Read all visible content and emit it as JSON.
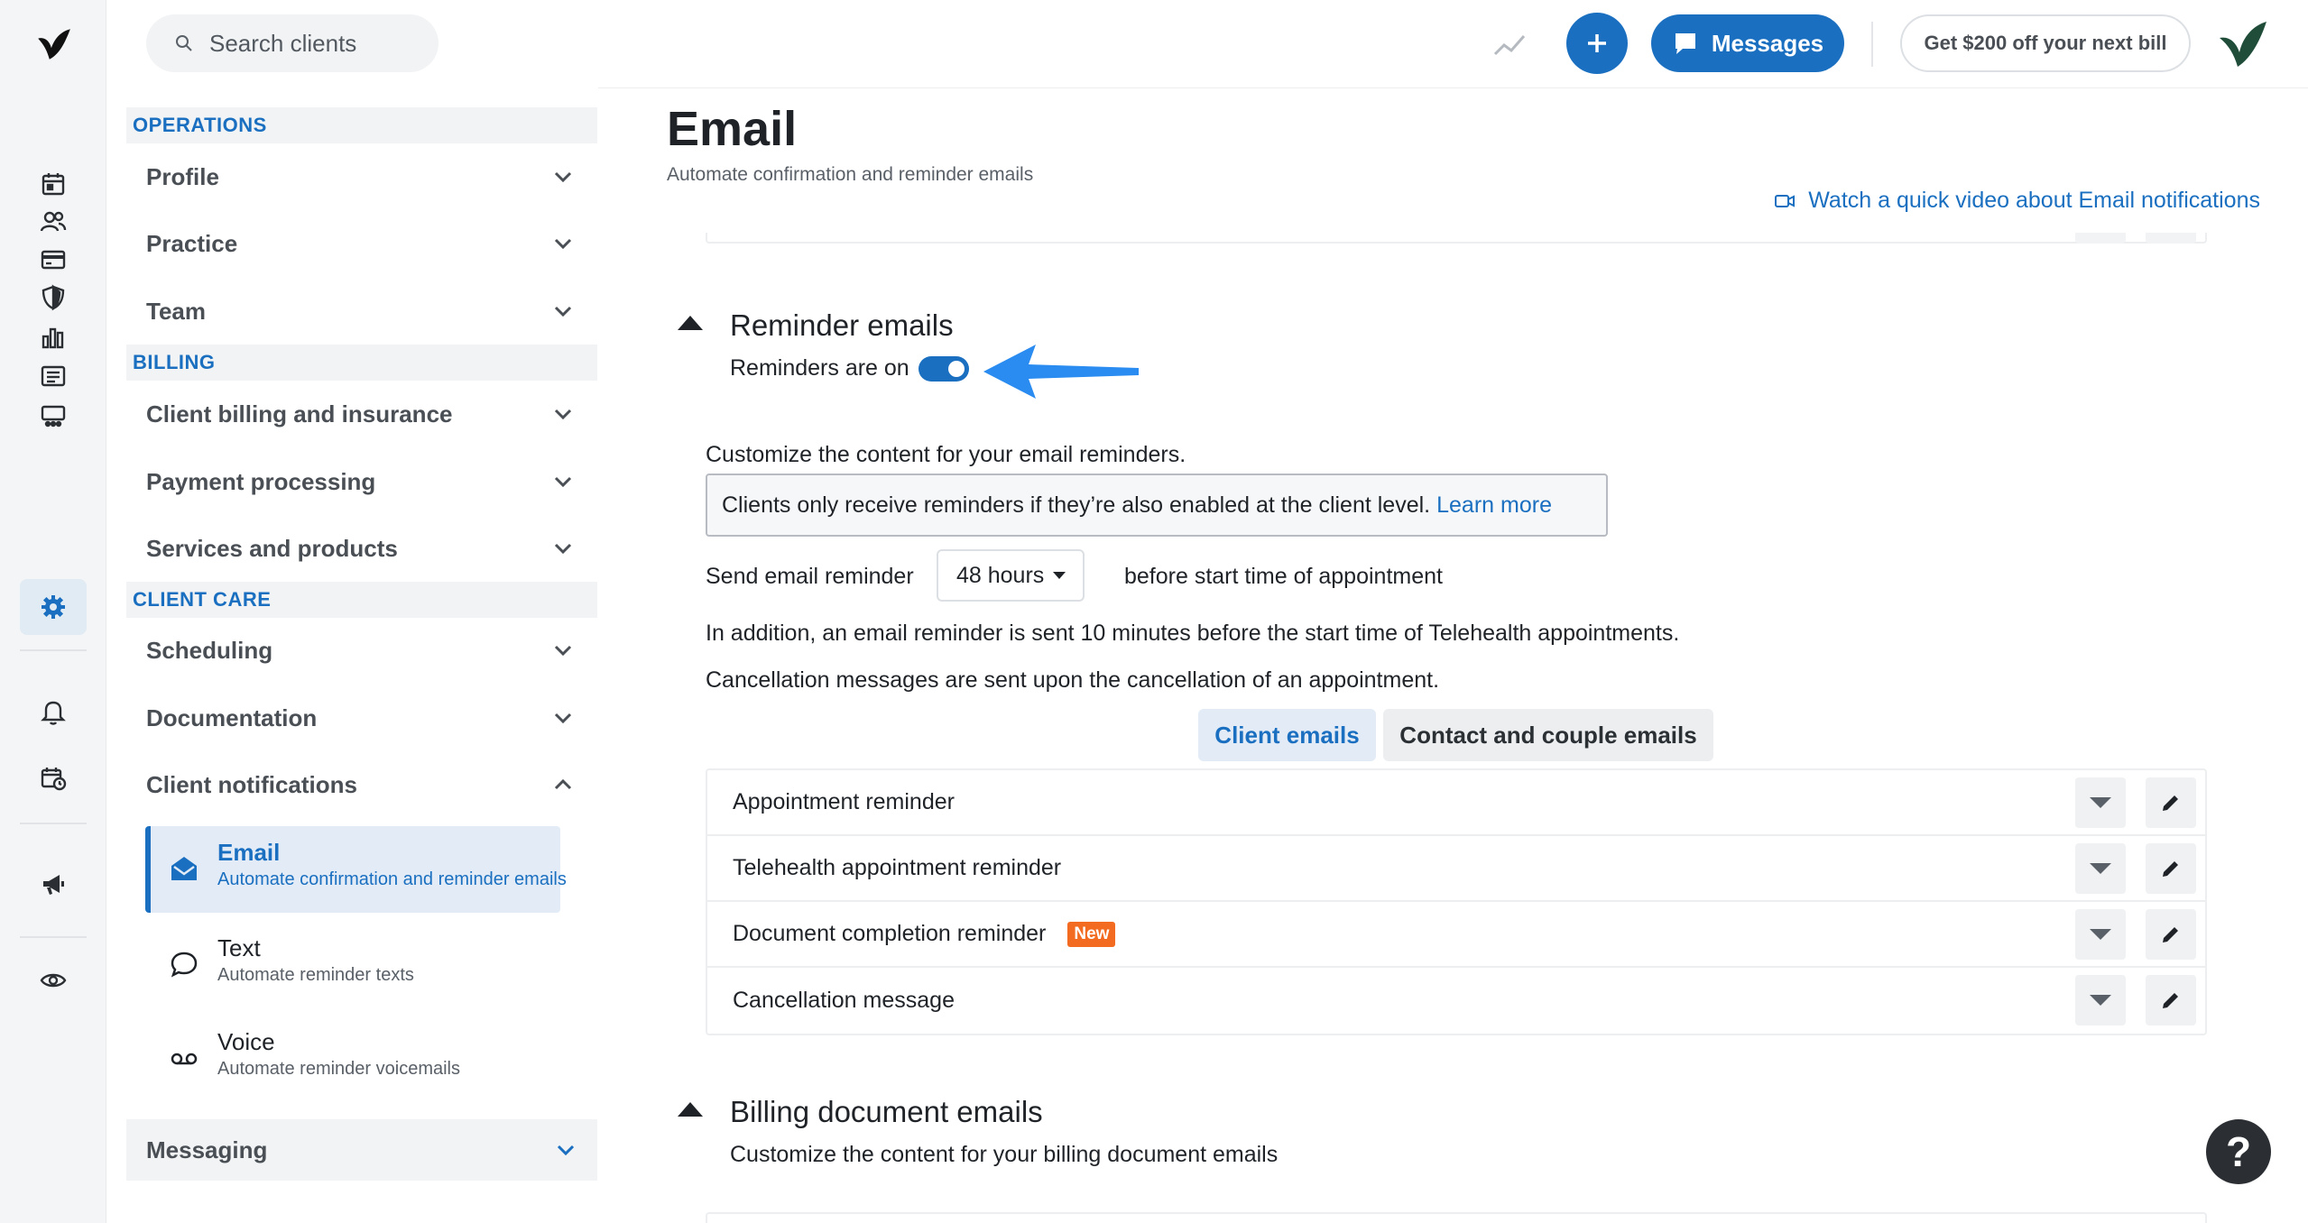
{
  "search": {
    "placeholder": "Search clients"
  },
  "header": {
    "messages_label": "Messages",
    "promo_label": "Get $200 off your next bill"
  },
  "sidebar": {
    "sections": {
      "operations": "OPERATIONS",
      "billing": "BILLING",
      "client_care": "CLIENT CARE"
    },
    "items": {
      "profile": "Profile",
      "practice": "Practice",
      "team": "Team",
      "client_billing": "Client billing and insurance",
      "payment_processing": "Payment processing",
      "services_products": "Services and products",
      "scheduling": "Scheduling",
      "documentation": "Documentation",
      "client_notifications": "Client notifications",
      "messaging": "Messaging"
    },
    "notifications_sub": [
      {
        "title": "Email",
        "desc": "Automate confirmation and reminder emails"
      },
      {
        "title": "Text",
        "desc": "Automate reminder texts"
      },
      {
        "title": "Voice",
        "desc": "Automate reminder voicemails"
      }
    ]
  },
  "main": {
    "title": "Email",
    "subtitle": "Automate confirmation and reminder emails",
    "video_link": "Watch a quick video about Email notifications",
    "reminder_section": {
      "title": "Reminder emails",
      "toggle_label": "Reminders are on",
      "toggle_on": true,
      "customize_text": "Customize the content for your email reminders.",
      "info_text": "Clients only receive reminders if they’re also enabled at the client level.",
      "learn_more": "Learn more",
      "send_prefix": "Send email reminder",
      "send_value": "48 hours",
      "send_suffix": "before start time of appointment",
      "telehealth_note": "In addition, an email reminder is sent 10 minutes before the start time of Telehealth appointments.",
      "cancellation_note": "Cancellation messages are sent upon the cancellation of an appointment."
    },
    "tabs": [
      {
        "label": "Client emails",
        "active": true
      },
      {
        "label": "Contact and couple emails",
        "active": false
      }
    ],
    "emails": [
      {
        "name": "Appointment reminder",
        "badge": ""
      },
      {
        "name": "Telehealth appointment reminder",
        "badge": ""
      },
      {
        "name": "Document completion reminder",
        "badge": "New"
      },
      {
        "name": "Cancellation message",
        "badge": ""
      }
    ],
    "billing_section": {
      "title": "Billing document emails",
      "desc": "Customize the content for your billing document emails"
    }
  },
  "help_label": "?",
  "colors": {
    "accent": "#1a6fc0",
    "badge": "#f26b21",
    "logo": "#1f4d3a"
  }
}
